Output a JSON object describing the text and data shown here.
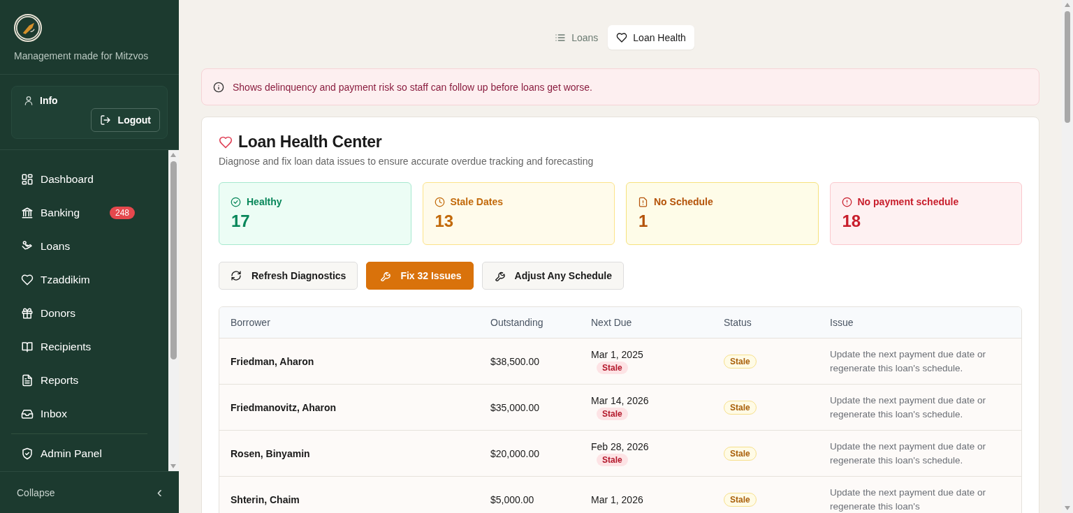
{
  "sidebar": {
    "tagline": "Management made for Mitzvos",
    "user": {
      "label": "Info",
      "logout": "Logout"
    },
    "nav": [
      {
        "label": "Dashboard",
        "kind": "grid"
      },
      {
        "label": "Banking",
        "kind": "bank",
        "badge": "248"
      },
      {
        "label": "Loans",
        "kind": "hand"
      },
      {
        "label": "Tzaddikim",
        "kind": "heart"
      },
      {
        "label": "Donors",
        "kind": "gift"
      },
      {
        "label": "Recipients",
        "kind": "book"
      },
      {
        "label": "Reports",
        "kind": "file"
      },
      {
        "label": "Inbox",
        "kind": "inbox"
      },
      {
        "label": "Admin Panel",
        "kind": "shield",
        "separated": true
      }
    ],
    "collapse": "Collapse",
    "collapse_icon": "‹"
  },
  "tabs": [
    {
      "label": "Loans",
      "kind": "list",
      "selected": false
    },
    {
      "label": "Loan Health",
      "kind": "heart",
      "selected": true
    }
  ],
  "alert": "Shows delinquency and payment risk so staff can follow up before loans get worse.",
  "card": {
    "title": "Loan Health Center",
    "subtitle": "Diagnose and fix loan data issues to ensure accurate overdue tracking and forecasting",
    "stats": [
      {
        "kind": "healthy",
        "label": "Healthy",
        "value": "17"
      },
      {
        "kind": "stale",
        "label": "Stale Dates",
        "value": "13"
      },
      {
        "kind": "warning",
        "label": "No Schedule",
        "value": "1"
      },
      {
        "kind": "danger",
        "label": "No payment schedule",
        "value": "18"
      }
    ],
    "actions": [
      {
        "kind": "refresh",
        "label": "Refresh Diagnostics",
        "primary": false
      },
      {
        "kind": "fix",
        "label": "Fix 32 Issues",
        "primary": true
      },
      {
        "kind": "adjust",
        "label": "Adjust Any Schedule",
        "primary": false
      }
    ],
    "table": {
      "columns": [
        "Borrower",
        "Outstanding",
        "Next Due",
        "Status",
        "Issue"
      ],
      "rows": [
        {
          "borrower": "Friedman, Aharon",
          "outstanding": "$38,500.00",
          "next_due": "Mar 1, 2025",
          "due_badge": "Stale",
          "status": "Stale",
          "issue": "Update the next payment due date or regenerate this loan's schedule."
        },
        {
          "borrower": "Friedmanovitz, Aharon",
          "outstanding": "$35,000.00",
          "next_due": "Mar 14, 2026",
          "due_badge": "Stale",
          "status": "Stale",
          "issue": "Update the next payment due date or regenerate this loan's schedule."
        },
        {
          "borrower": "Rosen, Binyamin",
          "outstanding": "$20,000.00",
          "next_due": "Feb 28, 2026",
          "due_badge": "Stale",
          "status": "Stale",
          "issue": "Update the next payment due date or regenerate this loan's schedule."
        },
        {
          "borrower": "Shterin, Chaim",
          "outstanding": "$5,000.00",
          "next_due": "Mar 1, 2026",
          "status": "Stale",
          "issue": "Update the next payment due date or regenerate this loan's"
        }
      ]
    }
  }
}
